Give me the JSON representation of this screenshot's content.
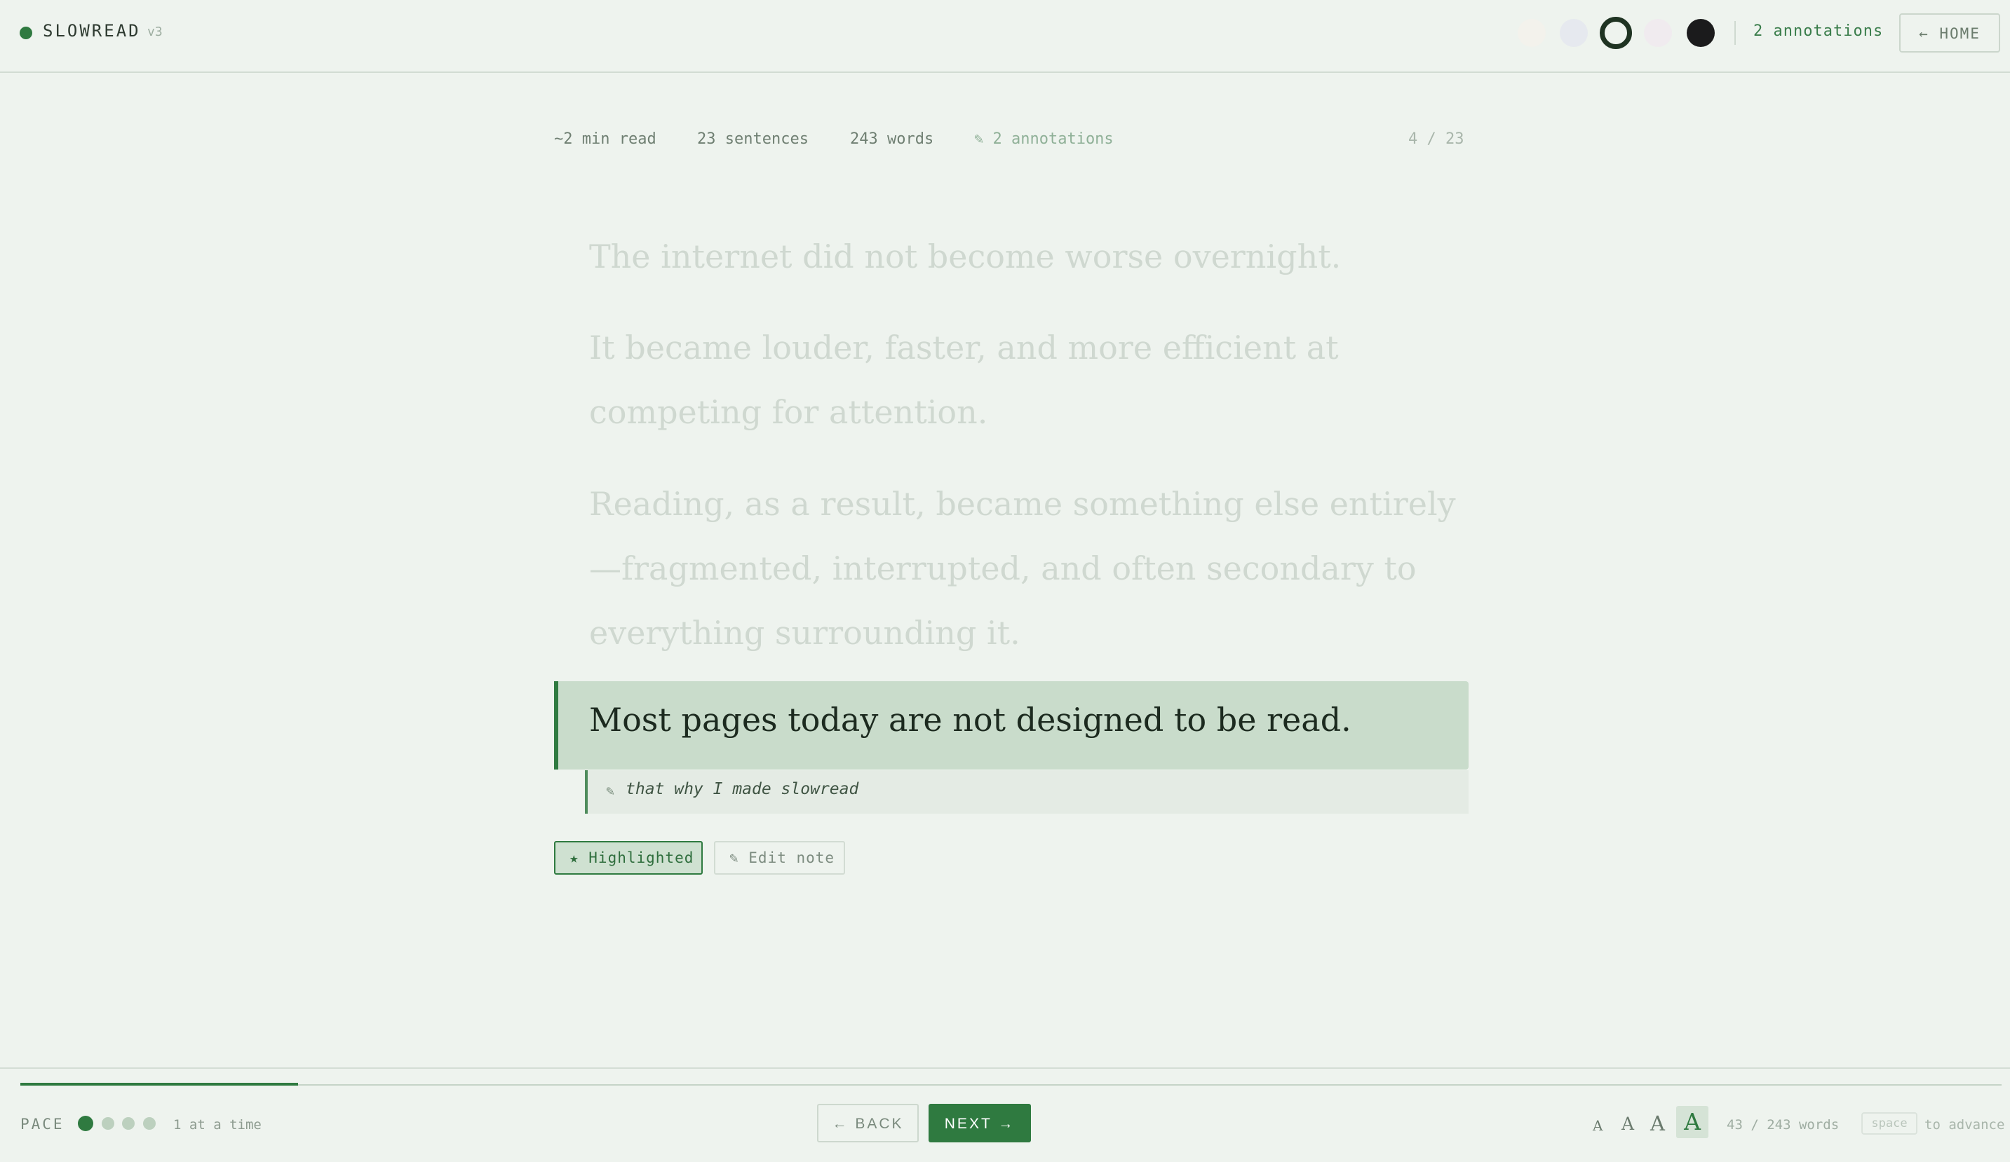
{
  "app": {
    "name": "SLOWREAD",
    "version": "v3"
  },
  "header": {
    "themes": [
      {
        "name": "paper",
        "color": "#f3f2ec"
      },
      {
        "name": "slate",
        "color": "#e6e9ef"
      },
      {
        "name": "sage",
        "color": "#eef3ee",
        "selected": true
      },
      {
        "name": "lavender",
        "color": "#f0ebef"
      },
      {
        "name": "night",
        "color": "#1b1b1c"
      }
    ],
    "annotations_label": "2 annotations",
    "home_label": "← HOME"
  },
  "meta": {
    "read_time": "~2 min read",
    "sentences": "23 sentences",
    "words": "243 words",
    "annotations": "✎ 2 annotations",
    "position": "4 / 23"
  },
  "reader": {
    "previous": [
      "The internet did not become worse overnight.",
      "It became louder, faster, and more efficient at competing for attention.",
      "Reading, as a result, became something else entirely—fragmented, interrupted, and often secondary to everything surrounding it."
    ],
    "current": "Most pages today are not designed to be read.",
    "note_icon": "✎",
    "note": "that why I made slowread",
    "highlight_label": "★ Highlighted",
    "edit_note_label": "✎ Edit note"
  },
  "footer": {
    "progress_fraction": 0.14,
    "pace_label": "PACE",
    "pace_level": 1,
    "pace_levels": 4,
    "pace_text": "1 at a time",
    "back_label": "← BACK",
    "next_label": "NEXT →",
    "font_size_glyph": "A",
    "font_size_selected": 4,
    "word_progress": "43 / 243 words",
    "key_hint": "space",
    "key_hint_text": "to advance"
  },
  "colors": {
    "accent": "#2f7a40",
    "background": "#eef3ee",
    "highlight": "#c9dccb"
  }
}
